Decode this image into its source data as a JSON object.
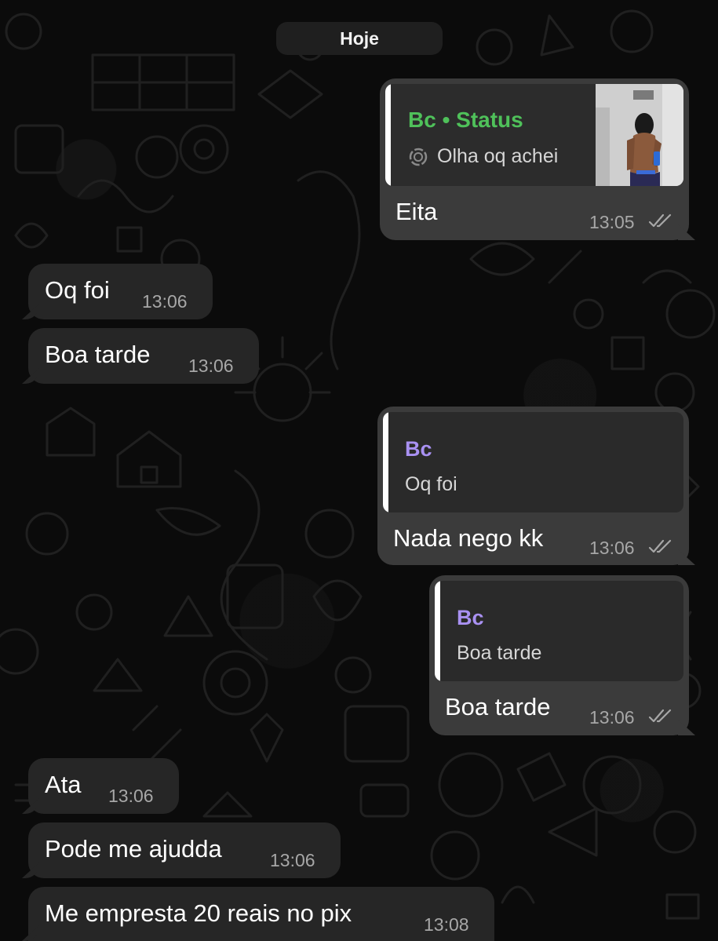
{
  "date_label": "Hoje",
  "colors": {
    "status_green": "#4fc15a",
    "quote_purple": "#a991f2",
    "incoming_bubble": "#262626",
    "outgoing_bubble": "#3b3b3b",
    "tick_gray": "#a7a7a7"
  },
  "messages": [
    {
      "direction": "outgoing",
      "quote": {
        "sender": "Bc • Status",
        "text": "Olha oq achei",
        "icon": "status-ring-icon",
        "thumbnail": "status-photo"
      },
      "text": "Eita",
      "time": "13:05",
      "ticks": "double-check-icon"
    },
    {
      "direction": "incoming",
      "text": "Oq foi",
      "time": "13:06"
    },
    {
      "direction": "incoming",
      "text": "Boa tarde",
      "time": "13:06"
    },
    {
      "direction": "outgoing",
      "quote": {
        "sender": "Bc",
        "text": "Oq foi"
      },
      "text": "Nada nego kk",
      "time": "13:06",
      "ticks": "double-check-icon"
    },
    {
      "direction": "outgoing",
      "quote": {
        "sender": "Bc",
        "text": "Boa tarde"
      },
      "text": "Boa tarde",
      "time": "13:06",
      "ticks": "double-check-icon"
    },
    {
      "direction": "incoming",
      "text": "Ata",
      "time": "13:06"
    },
    {
      "direction": "incoming",
      "text": "Pode me ajudda",
      "time": "13:06"
    },
    {
      "direction": "incoming",
      "text": "Me empresta 20 reais no pix",
      "time": "13:08"
    }
  ]
}
